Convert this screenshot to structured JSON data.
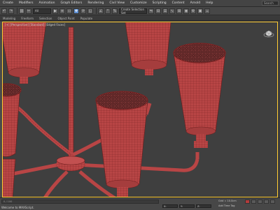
{
  "menubar": {
    "items": [
      "Create",
      "Modifiers",
      "Animation",
      "Graph Editors",
      "Rendering",
      "Civil View",
      "Customize",
      "Scripting",
      "Content",
      "Arnold",
      "Help"
    ],
    "search_placeholder": "Search"
  },
  "toolbar": {
    "selection_filter": "All",
    "named_selection": "Create Selection Set"
  },
  "ribbon": {
    "tabs": [
      "Modeling",
      "Freeform",
      "Selection",
      "Object Paint",
      "Populate"
    ]
  },
  "viewport": {
    "label": "[+] [Perspective] [Standard] [Edged Faces]"
  },
  "statusbar": {
    "timeline": "0 / 100",
    "status_text": "Welcome to MAXScript.",
    "x_label": "X:",
    "y_label": "Y:",
    "z_label": "Z:",
    "grid": "Grid = 10.0cm",
    "add_time_tag": "Add Time Tag"
  },
  "colors": {
    "model": "#b84545",
    "wire": "#6a1c1c",
    "viewport_bg": "#3f3f3f",
    "accent": "#5f8fd1"
  }
}
